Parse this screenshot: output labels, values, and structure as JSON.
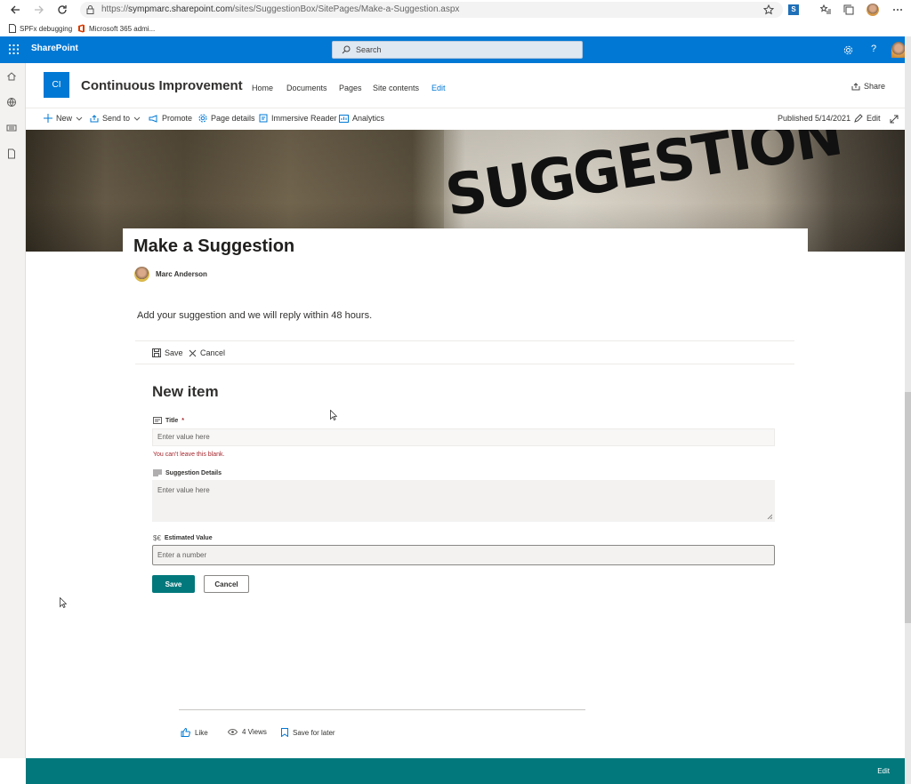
{
  "browser": {
    "url_prefix": "https://",
    "url_host": "sympmarc.sharepoint.com",
    "url_path": "/sites/SuggestionBox/SitePages/Make-a-Suggestion.aspx",
    "bookmarks": [
      "SPFx debugging",
      "Microsoft 365 admi..."
    ]
  },
  "suite": {
    "brand": "SharePoint",
    "search_placeholder": "Search"
  },
  "site": {
    "logo_text": "CI",
    "title": "Continuous Improvement",
    "nav": [
      "Home",
      "Documents",
      "Pages",
      "Site contents",
      "Edit"
    ],
    "share_label": "Share"
  },
  "command_bar": {
    "new": "New",
    "send_to": "Send to",
    "promote": "Promote",
    "page_details": "Page details",
    "immersive_reader": "Immersive Reader",
    "analytics": "Analytics",
    "published": "Published 5/14/2021",
    "edit": "Edit"
  },
  "hero": {
    "word": "SUGGESTION"
  },
  "page": {
    "title": "Make a Suggestion",
    "author": "Marc Anderson",
    "intro": "Add your suggestion and we will reply within 48 hours."
  },
  "form": {
    "save_cmd": "Save",
    "cancel_cmd": "Cancel",
    "heading": "New item",
    "title_label": "Title",
    "required_marker": "*",
    "title_placeholder": "Enter value here",
    "title_error": "You can't leave this blank.",
    "details_label": "Suggestion Details",
    "details_placeholder": "Enter value here",
    "value_label": "Estimated Value",
    "value_placeholder": "Enter a number",
    "save_button": "Save",
    "cancel_button": "Cancel"
  },
  "footer": {
    "like": "Like",
    "views": "4 Views",
    "save_later": "Save for later",
    "bottom_edit": "Edit"
  },
  "colors": {
    "suite_blue": "#0078d4",
    "teal": "#03787c",
    "error_red": "#a4262c"
  }
}
